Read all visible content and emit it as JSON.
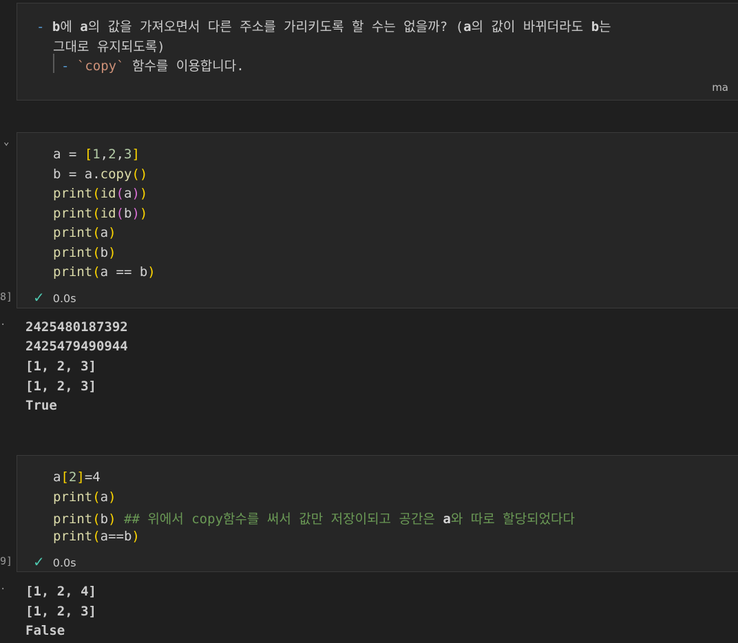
{
  "markdown_cell": {
    "line1_dash": "- ",
    "line1_b": "b",
    "line1_part1": "에 ",
    "line1_a": "a",
    "line1_part2": "의 값을 가져오면서 다른 주소를 가리키도록 할 수는 없을까? (",
    "line1_a2": "a",
    "line1_part3": "의 값이 바뀌더라도 ",
    "line1_b2": "b",
    "line1_part4": "는",
    "line2": "그대로 유지되도록)",
    "line3_dash": "- ",
    "line3_code": "`copy`",
    "line3_rest": " 함수를 이용합니다.",
    "lang_tag": "ma"
  },
  "cell1": {
    "exec_count": "8]",
    "status_time": "0.0s",
    "code": {
      "l1": {
        "a": "a = ",
        "open": "[",
        "n1": "1",
        "c1": ",",
        "n2": "2",
        "c2": ",",
        "n3": "3",
        "close": "]"
      },
      "l2": {
        "pre": "b = a.",
        "fn": "copy",
        "open": "(",
        "close": ")"
      },
      "l3": {
        "fn": "print",
        "o1": "(",
        "fn2": "id",
        "o2": "(",
        "arg": "a",
        "c2": ")",
        "c1": ")"
      },
      "l4": {
        "fn": "print",
        "o1": "(",
        "fn2": "id",
        "o2": "(",
        "arg": "b",
        "c2": ")",
        "c1": ")"
      },
      "l5": {
        "fn": "print",
        "o1": "(",
        "arg": "a",
        "c1": ")"
      },
      "l6": {
        "fn": "print",
        "o1": "(",
        "arg": "b",
        "c1": ")"
      },
      "l7": {
        "fn": "print",
        "o1": "(",
        "arg": "a == b",
        "c1": ")"
      }
    },
    "output": [
      "2425480187392",
      "2425479490944",
      "[1, 2, 3]",
      "[1, 2, 3]",
      "True"
    ]
  },
  "cell2": {
    "exec_count": "9]",
    "status_time": "0.0s",
    "code": {
      "l1": {
        "pre": "a",
        "open": "[",
        "n": "2",
        "close": "]",
        "rest": "=4"
      },
      "l2": {
        "fn": "print",
        "o1": "(",
        "arg": "a",
        "c1": ")"
      },
      "l3": {
        "fn": "print",
        "o1": "(",
        "arg": "b",
        "c1": ")",
        "comment": " ## 위에서 copy함수를 써서 값만 저장이되고 공간은 ",
        "comment_a": "a",
        "comment_rest": "와 따로 할당되었다다"
      },
      "l4": {
        "fn": "print",
        "o1": "(",
        "arg": "a==b",
        "c1": ")"
      }
    },
    "output": [
      "[1, 2, 4]",
      "[1, 2, 3]",
      "False"
    ]
  },
  "icons": {
    "check": "✓",
    "collapse": "⌄",
    "output_dot": "·"
  },
  "colors": {
    "background": "#1f1f1f",
    "cell_background": "#262626",
    "function": "#dcdcaa",
    "bracket1": "#ffd700",
    "bracket2": "#da70d6",
    "number": "#b5cea8",
    "comment": "#6a9955",
    "check": "#4ec9b0"
  }
}
